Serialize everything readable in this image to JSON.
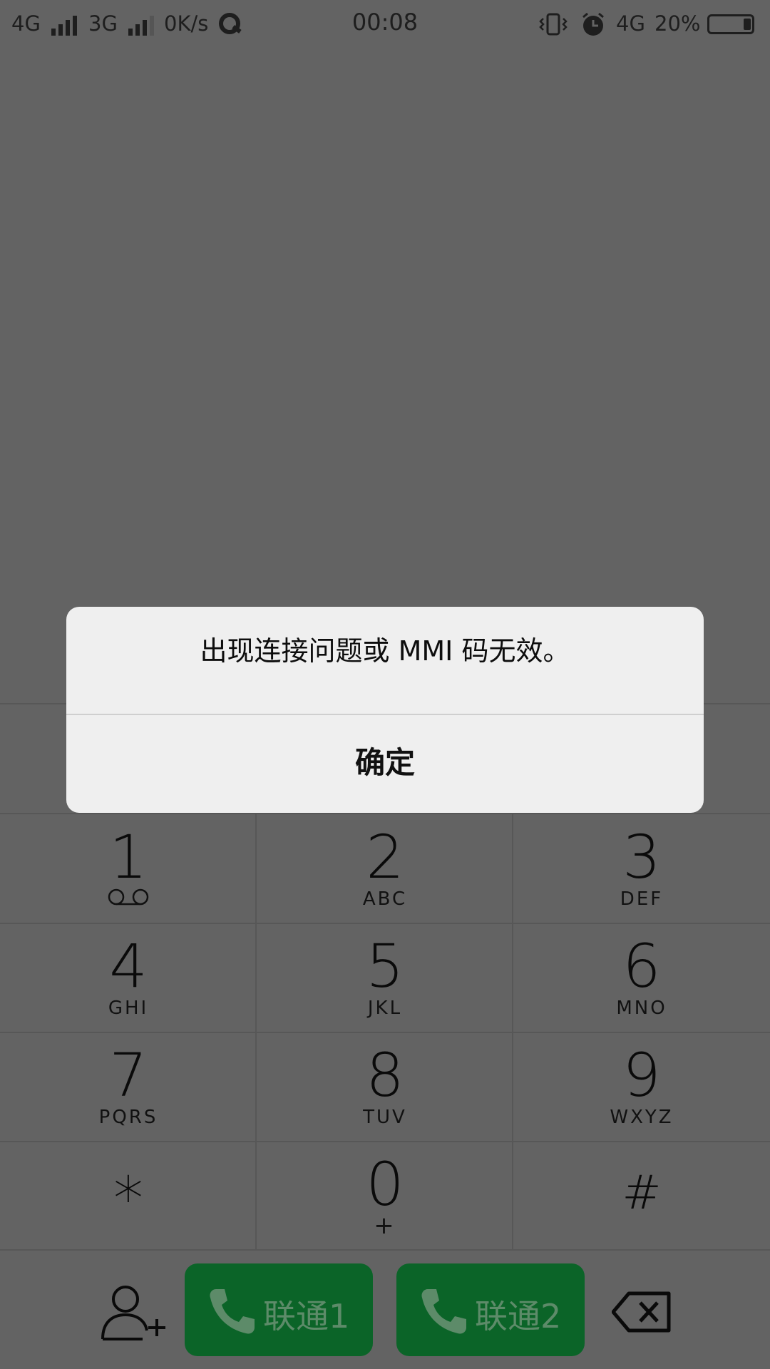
{
  "status_bar": {
    "net1": "4G",
    "net2": "3G",
    "speed": "0K/s",
    "time": "00:08",
    "net3": "4G",
    "battery_pct": "20%",
    "battery_level": 0.2
  },
  "dialog": {
    "message": "出现连接问题或 MMI 码无效。",
    "ok_label": "确定"
  },
  "keypad": {
    "keys": [
      {
        "num": "1",
        "letters": ""
      },
      {
        "num": "2",
        "letters": "ABC"
      },
      {
        "num": "3",
        "letters": "DEF"
      },
      {
        "num": "4",
        "letters": "GHI"
      },
      {
        "num": "5",
        "letters": "JKL"
      },
      {
        "num": "6",
        "letters": "MNO"
      },
      {
        "num": "7",
        "letters": "PQRS"
      },
      {
        "num": "8",
        "letters": "TUV"
      },
      {
        "num": "9",
        "letters": "WXYZ"
      },
      {
        "num": "*",
        "letters": ""
      },
      {
        "num": "0",
        "letters": "+"
      },
      {
        "num": "#",
        "letters": ""
      }
    ]
  },
  "bottom_bar": {
    "call1_label": "联通1",
    "call2_label": "联通2",
    "icons": [
      "add-contact-icon",
      "phone-icon",
      "backspace-icon"
    ]
  },
  "colors": {
    "background": "#636363",
    "dialog_bg": "#efefef",
    "call_button": "#0b6428"
  }
}
